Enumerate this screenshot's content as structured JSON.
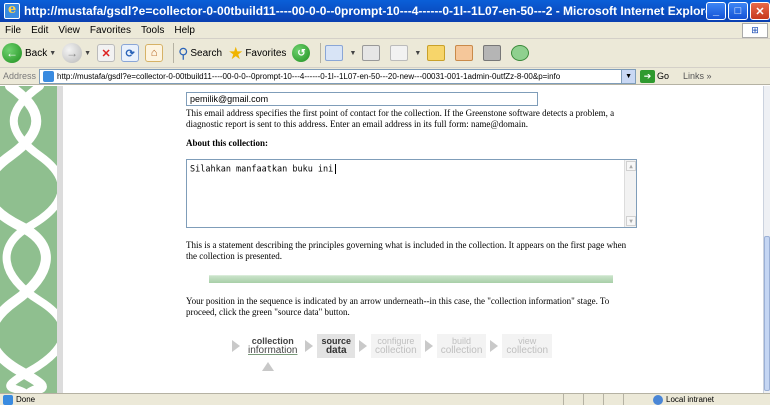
{
  "window": {
    "title": "http://mustafa/gsdl?e=collector-0-00tbuild11----00-0-0--0prompt-10---4------0-1l--1L07-en-50---2 - Microsoft Internet Explorer",
    "minimize": "_",
    "maximize": "□",
    "close": "✕"
  },
  "menu": {
    "items": [
      "File",
      "Edit",
      "View",
      "Favorites",
      "Tools",
      "Help"
    ]
  },
  "toolbar": {
    "back": "Back",
    "search": "Search",
    "favorites": "Favorites"
  },
  "address": {
    "label": "Address",
    "url": "http://mustafa/gsdl?e=collector-0-00tbuild11----00-0-0--0prompt-10---4------0-1l--1L07-en-50---20-new---00031-001-1admin-0utfZz-8-00&p=info",
    "go": "Go",
    "links": "Links »"
  },
  "form": {
    "email_value": "pemilik@gmail.com",
    "email_help": "This email address specifies the first point of contact for the collection. If the Greenstone software detects a problem, a diagnostic report is sent to this address. Enter an email address in its full form: name@domain.",
    "about_label": "About this collection:",
    "about_value": "Silahkan manfaatkan buku ini",
    "about_help": "This is a statement describing the principles governing what is included in the collection. It appears on the first page when the collection is presented.",
    "sequence_help": "Your position in the sequence is indicated by an arrow underneath--in this case, the \"collection information\" stage. To proceed, click the green \"source data\" button."
  },
  "steps": [
    {
      "line1": "collection",
      "line2": "information",
      "state": "current"
    },
    {
      "line1": "source",
      "line2": "data",
      "state": "next"
    },
    {
      "line1": "configure",
      "line2": "collection",
      "state": "disabled"
    },
    {
      "line1": "build",
      "line2": "collection",
      "state": "disabled"
    },
    {
      "line1": "view",
      "line2": "collection",
      "state": "disabled"
    }
  ],
  "status": {
    "text": "Done",
    "zone": "Local intranet"
  }
}
